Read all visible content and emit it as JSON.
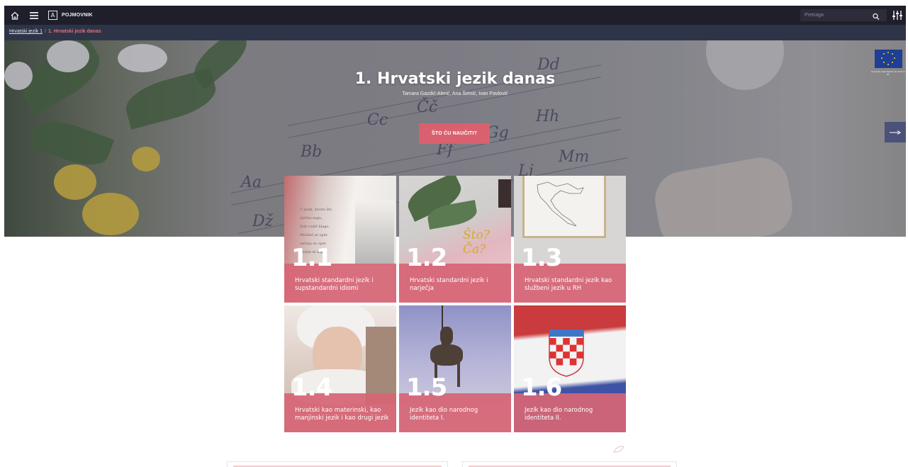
{
  "topbar": {
    "home_icon": "home-icon",
    "menu_icon": "hamburger-menu-icon",
    "glossary_box": "A",
    "glossary_label": "POJMOVNIK",
    "search_placeholder": "Pretraga",
    "search_icon": "search-icon",
    "settings_icon": "sliders-icon"
  },
  "breadcrumb": {
    "parent": "Hrvatski jezik 1",
    "separator": "/",
    "current": "1. Hrvatski jezik danas"
  },
  "hero": {
    "title": "1. Hrvatski jezik danas",
    "authors": "Tamara Gazdić-Alerić, Ana Širinić, Ivan Pavlović",
    "cta": "ŠTO ĆU NAUČITI?",
    "script_letters": [
      "Aa",
      "Bb",
      "Cc",
      "Čč",
      "Dd",
      "Ff",
      "Gg",
      "Hh",
      "Lj",
      "Mm",
      "Dž"
    ],
    "eu_caption": "Europska unija Zajedno do fondova EU",
    "next_icon": "arrow-right-icon"
  },
  "tiles": [
    {
      "number": "1.1",
      "title": "Hrvatski standardni jezik i supstandardni idiomi"
    },
    {
      "number": "1.2",
      "title": "Hrvatski standardni jezik i narječja"
    },
    {
      "number": "1.3",
      "title": "Hrvatski standardni jezik kao službeni jezik u RH"
    },
    {
      "number": "1.4",
      "title": "Hrvatski kao materinski, kao manjinski jezik i kao drugi jezik"
    },
    {
      "number": "1.5",
      "title": "Jezik kao dio narodnog identiteta I."
    },
    {
      "number": "1.6",
      "title": "Jezik kao dio narodnog identiteta II."
    }
  ],
  "tile_texts": {
    "book_lines": [
      "U jezik, životu što",
      "vječnu sagu,",
      "Dok vodiš blago,",
      "Mirišeš se opet",
      "unčeju se opet",
      "Molim te kapi."
    ],
    "notebook_text": "Što? Ča?"
  },
  "colors": {
    "topbar": "#1f1f2b",
    "crumbbar": "#2e3448",
    "accent": "#d9616f",
    "tile_band": "#d66575"
  }
}
